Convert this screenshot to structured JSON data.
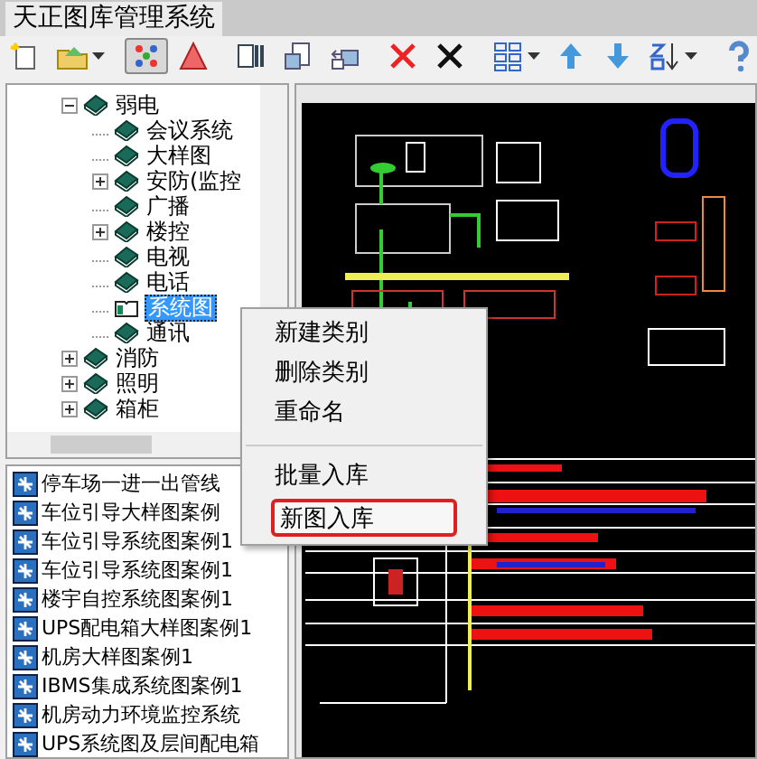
{
  "window": {
    "title": "天正图库管理系统"
  },
  "toolbar": [
    {
      "pressed": false
    },
    {
      "pressed": false
    },
    {
      "pressed": true
    },
    {
      "pressed": false
    },
    {
      "pressed": false
    },
    {
      "pressed": false
    },
    {
      "pressed": false
    },
    {
      "pressed": false
    },
    {
      "pressed": false
    },
    {
      "pressed": false
    },
    {
      "pressed": false
    },
    {
      "pressed": false
    },
    {
      "pressed": false
    },
    {
      "pressed": false
    }
  ],
  "tree": [
    {
      "label": "弱电",
      "expanded": true,
      "selected": false,
      "children": [
        {
          "label": "会议系统",
          "selected": false
        },
        {
          "label": "大样图",
          "selected": false
        },
        {
          "label": "安防(监控",
          "selected": false,
          "expanded": false
        },
        {
          "label": "广播",
          "selected": false
        },
        {
          "label": "楼控",
          "selected": false,
          "expanded": false
        },
        {
          "label": "电视",
          "selected": false
        },
        {
          "label": "电话",
          "selected": false
        },
        {
          "label": "系统图",
          "selected": true
        },
        {
          "label": "通讯",
          "selected": false
        }
      ]
    },
    {
      "label": "消防",
      "expanded": false,
      "selected": false
    },
    {
      "label": "照明",
      "expanded": false,
      "selected": false
    },
    {
      "label": "箱柜",
      "expanded": false,
      "selected": false
    }
  ],
  "files": [
    "停车场一进一出管线",
    "车位引导大样图案例",
    "车位引导系统图案例1",
    "车位引导系统图案例1",
    "楼宇自控系统图案例1",
    "UPS配电箱大样图案例1",
    "机房大样图案例1",
    "IBMS集成系统图案例1",
    "机房动力环境监控系统",
    "UPS系统图及层间配电箱"
  ],
  "context_menu": [
    {
      "kind": "item",
      "label": "新建类别",
      "highlighted": false
    },
    {
      "kind": "item",
      "label": "删除类别",
      "highlighted": false
    },
    {
      "kind": "item",
      "label": "重命名",
      "highlighted": false
    },
    {
      "kind": "separator"
    },
    {
      "kind": "item",
      "label": "批量入库",
      "highlighted": false
    },
    {
      "kind": "item",
      "label": "新图入库",
      "highlighted": true
    }
  ]
}
